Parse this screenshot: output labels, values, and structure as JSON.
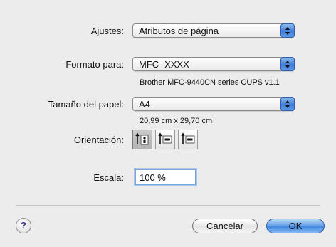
{
  "settings": {
    "label": "Ajustes:",
    "value": "Atributos de página"
  },
  "format_for": {
    "label": "Formato para:",
    "value": "MFC- XXXX",
    "printer_description": "Brother MFC-9440CN series CUPS v1.1"
  },
  "paper_size": {
    "label": "Tamaño del papel:",
    "value": "A4",
    "dimensions": "20,99 cm x 29,70 cm"
  },
  "orientation": {
    "label": "Orientación:",
    "options": [
      "portrait",
      "landscape-left",
      "landscape-right"
    ],
    "selected": "portrait"
  },
  "scale": {
    "label": "Escala:",
    "value": "100 %"
  },
  "buttons": {
    "help": "?",
    "cancel": "Cancelar",
    "ok": "OK"
  }
}
